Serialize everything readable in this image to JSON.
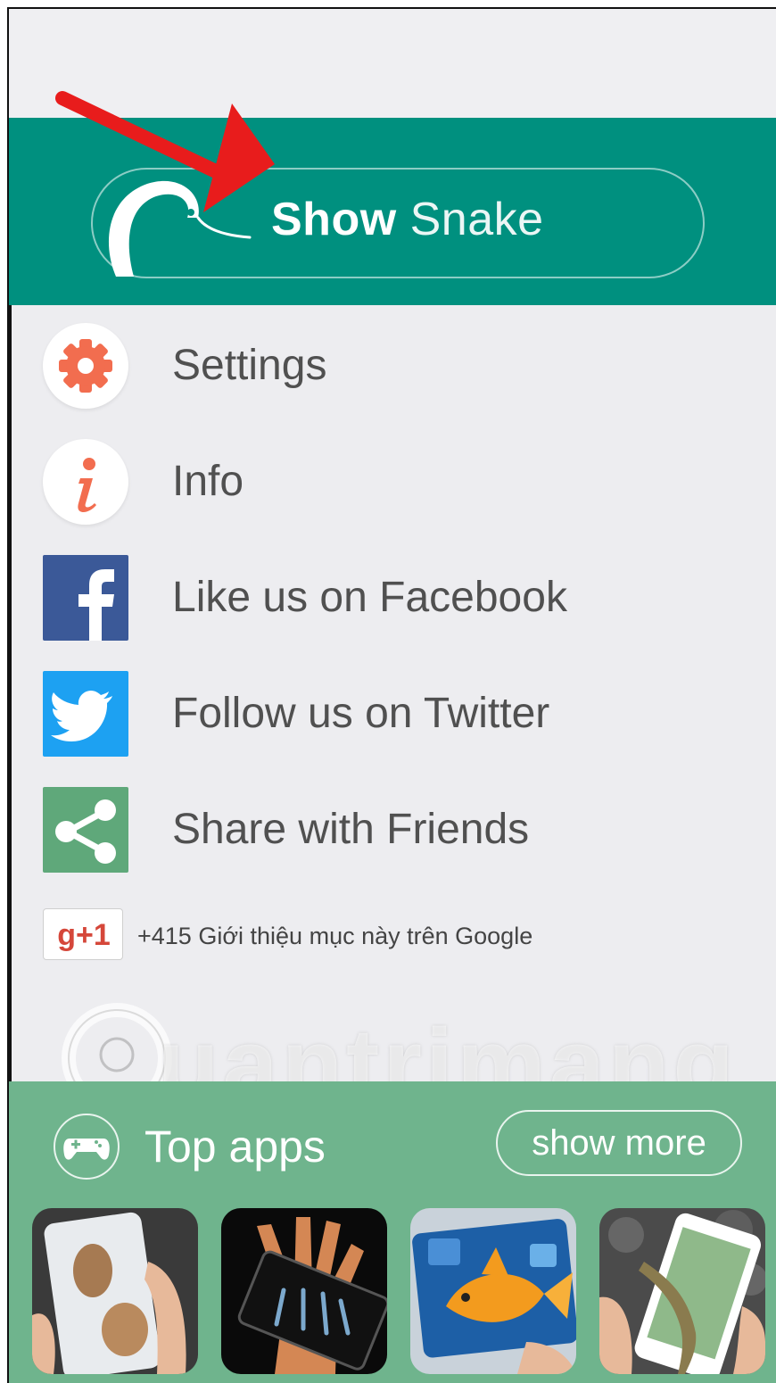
{
  "header": {
    "show_snake_word1": "Show",
    "show_snake_word2": "Snake"
  },
  "menu": {
    "items": [
      {
        "label": "Settings",
        "icon": "gear-icon"
      },
      {
        "label": "Info",
        "icon": "info-icon"
      },
      {
        "label": "Like us on Facebook",
        "icon": "facebook-icon"
      },
      {
        "label": "Follow us on Twitter",
        "icon": "twitter-icon"
      },
      {
        "label": "Share with Friends",
        "icon": "share-icon"
      }
    ]
  },
  "google_plus": {
    "button_label": "g+1",
    "count_text": "+415 Giới thiệu mục này trên Google"
  },
  "watermark": {
    "text": "uantrimang"
  },
  "top_apps": {
    "title": "Top apps",
    "show_more_label": "show more",
    "apps": [
      {
        "icon": "mouse-in-phone-icon"
      },
      {
        "icon": "xray-hand-icon"
      },
      {
        "icon": "goldfish-in-phone-icon"
      },
      {
        "icon": "lizard-in-phone-icon"
      }
    ]
  },
  "colors": {
    "teal": "#00907f",
    "green": "#6fb48d",
    "menu_bg": "#ededf0",
    "icon_orange": "#f26d4f",
    "facebook": "#3b5998",
    "twitter": "#1da1f2",
    "share": "#5fa87a",
    "arrow": "#e81c1c"
  }
}
